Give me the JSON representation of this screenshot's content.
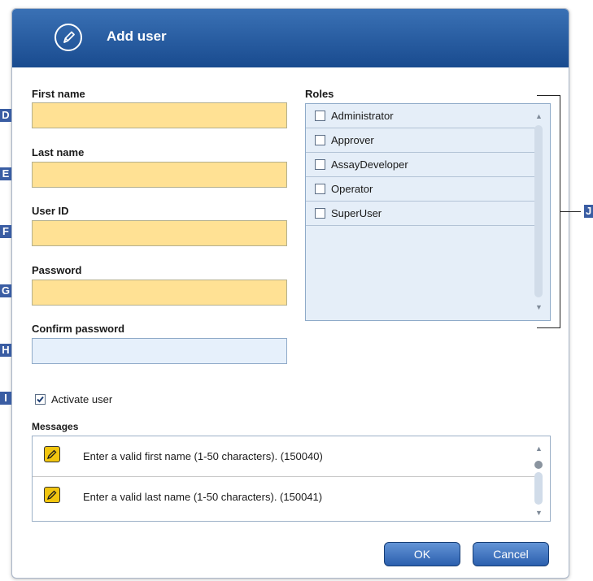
{
  "dialog": {
    "title": "Add user",
    "title_icon": "edit-pencil-circle-icon"
  },
  "form": {
    "first_name": {
      "label": "First name",
      "value": ""
    },
    "last_name": {
      "label": "Last name",
      "value": ""
    },
    "user_id": {
      "label": "User ID",
      "value": ""
    },
    "password": {
      "label": "Password",
      "value": ""
    },
    "confirm_password": {
      "label": "Confirm password",
      "value": ""
    },
    "activate_user": {
      "label": "Activate user",
      "checked": true
    }
  },
  "roles": {
    "label": "Roles",
    "items": [
      {
        "label": "Administrator",
        "checked": false
      },
      {
        "label": "Approver",
        "checked": false
      },
      {
        "label": "AssayDeveloper",
        "checked": false
      },
      {
        "label": "Operator",
        "checked": false
      },
      {
        "label": "SuperUser",
        "checked": false
      }
    ]
  },
  "messages": {
    "label": "Messages",
    "items": [
      {
        "text": "Enter a valid first name (1-50 characters). (150040)",
        "icon": "pencil-warning-icon"
      },
      {
        "text": "Enter a valid last name (1-50 characters). (150041)",
        "icon": "pencil-warning-icon"
      }
    ]
  },
  "buttons": {
    "ok": "OK",
    "cancel": "Cancel"
  },
  "markers": {
    "d": "D",
    "e": "E",
    "f": "F",
    "g": "G",
    "h": "H",
    "i": "I",
    "j": "J"
  },
  "colors": {
    "title_bar": "#194b8f",
    "required_field": "#ffe194",
    "optional_field": "#e6f0fb",
    "button": "#2b5fae"
  }
}
